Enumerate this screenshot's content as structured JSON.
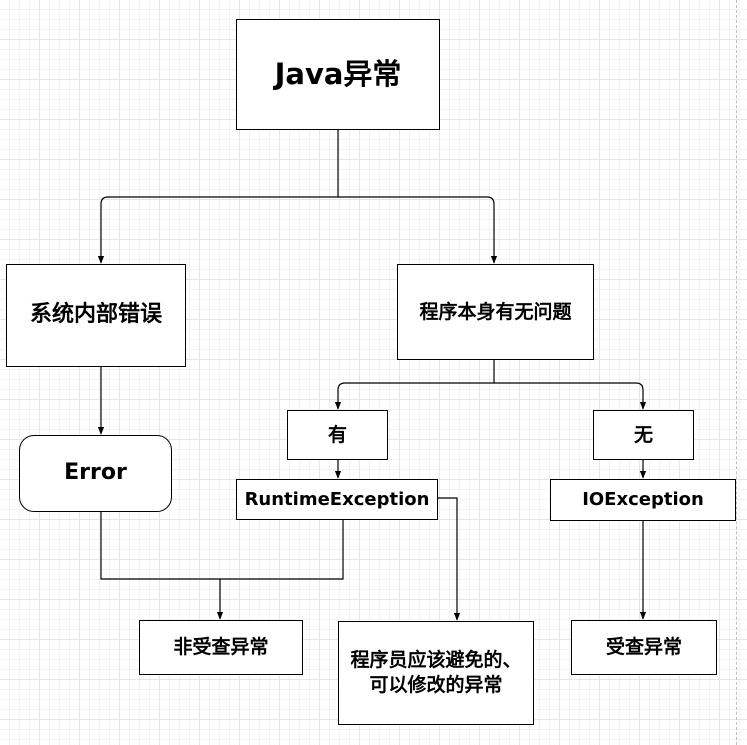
{
  "diagram": {
    "nodes": {
      "root": "Java异常",
      "system_error": "系统内部错误",
      "program_issue": "程序本身有无问题",
      "error": "Error",
      "yes": "有",
      "no": "无",
      "runtime_exception": "RuntimeException",
      "io_exception": "IOException",
      "unchecked": "非受查异常",
      "avoidable": "程序员应该避免的、可以修改的异常",
      "checked": "受查异常"
    }
  }
}
